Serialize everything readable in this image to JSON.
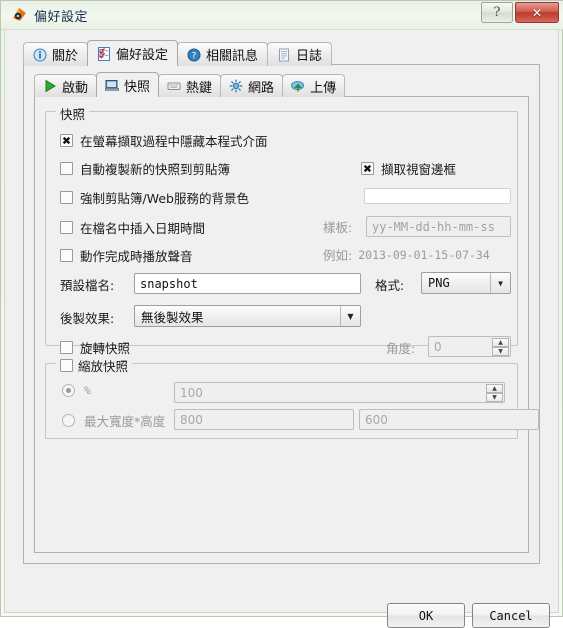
{
  "window": {
    "title": "偏好設定",
    "icon": "app-icon",
    "buttons": {
      "help": "?",
      "close": "✕"
    },
    "titlebar_color": "#eaf1e5",
    "close_color": "#b93b2d"
  },
  "outer_tabs": [
    {
      "label": "關於",
      "icon": "info-icon",
      "active": false
    },
    {
      "label": "偏好設定",
      "icon": "checklist-icon",
      "active": true
    },
    {
      "label": "相關訊息",
      "icon": "help-icon",
      "active": false
    },
    {
      "label": "日誌",
      "icon": "log-icon",
      "active": false
    }
  ],
  "inner_tabs": [
    {
      "label": "啟動",
      "icon": "play-icon",
      "active": false
    },
    {
      "label": "快照",
      "icon": "snapshot-icon",
      "active": true
    },
    {
      "label": "熱鍵",
      "icon": "hotkey-icon",
      "active": false
    },
    {
      "label": "網路",
      "icon": "network-icon",
      "active": false
    },
    {
      "label": "上傳",
      "icon": "upload-icon",
      "active": false
    }
  ],
  "snapshot_group": {
    "title": "快照",
    "hide_ui": {
      "label": "在螢幕擷取過程中隱藏本程式介面",
      "checked": true
    },
    "auto_copy": {
      "label": "自動複製新的快照到剪貼簿",
      "checked": false
    },
    "capture_border": {
      "label": "擷取視窗邊框",
      "checked": true
    },
    "force_bg": {
      "label": "強制剪貼簿/Web服務的背景色",
      "checked": false
    },
    "bg_color_value": "",
    "bg_color_hex": "#ffffff",
    "insert_datetime": {
      "label": "在檔名中插入日期時間",
      "checked": false
    },
    "play_sound": {
      "label": "動作完成時播放聲音",
      "checked": false
    },
    "template_label": "樣板:",
    "template_value": "yy-MM-dd-hh-mm-ss",
    "example_label": "例如:",
    "example_value": "2013-09-01-15-07-34",
    "filename_label": "預設檔名:",
    "filename_value": "snapshot",
    "format_label": "格式:",
    "format_value": "PNG",
    "effect_label": "後製效果:",
    "effect_value": "無後製效果",
    "rotate": {
      "label": "旋轉快照",
      "checked": false
    },
    "angle_label": "角度:",
    "angle_value": "0"
  },
  "scale_group": {
    "title": "縮放快照",
    "enabled": false,
    "percent_radio_label": "%",
    "percent_selected": true,
    "percent_value": "100",
    "maxsize_radio_label": "最大寬度*高度",
    "maxsize_selected": false,
    "width_value": "800",
    "height_value": "600"
  },
  "footer": {
    "ok_label": "OK",
    "cancel_label": "Cancel"
  }
}
